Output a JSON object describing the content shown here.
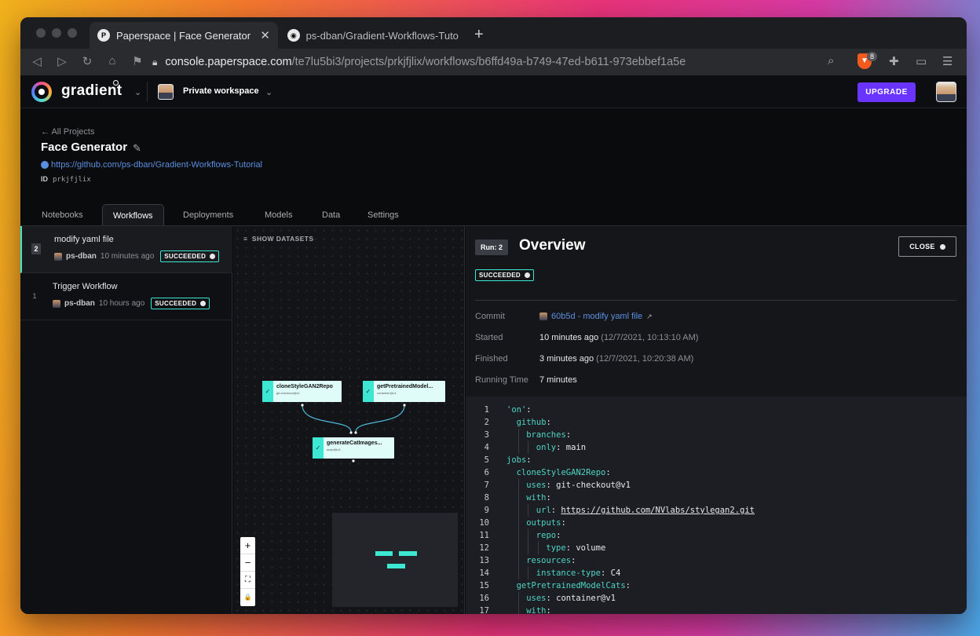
{
  "browser": {
    "tabs": [
      {
        "title": "Paperspace | Face Generator",
        "favicon": "P"
      },
      {
        "title": "ps-dban/Gradient-Workflows-Tutor",
        "favicon": "github-icon"
      }
    ],
    "url_host": "console.paperspace.com",
    "url_path": "/te7lu5bi3/projects/prkjfjlix/workflows/b6ffd49a-b749-47ed-b611-973ebbef1a5e",
    "shield_badge": "8"
  },
  "app": {
    "logo_text": "gradient",
    "workspace": "Private workspace",
    "upgrade_label": "UPGRADE"
  },
  "project": {
    "back_label": "← All Projects",
    "title": "Face Generator",
    "repo_url": "https://github.com/ps-dban/Gradient-Workflows-Tutorial",
    "id_label": "ID",
    "id_value": "prkjfjlix",
    "tabs": [
      "Notebooks",
      "Workflows",
      "Deployments",
      "Models",
      "Data",
      "Settings"
    ],
    "active_tab": "Workflows"
  },
  "runs": [
    {
      "num": "2",
      "title": "modify yaml file",
      "user": "ps-dban",
      "time": "10 minutes ago",
      "status": "SUCCEEDED"
    },
    {
      "num": "1",
      "title": "Trigger Workflow",
      "user": "ps-dban",
      "time": "10 hours ago",
      "status": "SUCCEEDED"
    }
  ],
  "graph": {
    "show_datasets": "SHOW DATASETS",
    "nodes": [
      {
        "name": "cloneStyleGAN2Repo",
        "sub": "git-checkout@v1"
      },
      {
        "name": "getPretrainedModel...",
        "sub": "container@v1"
      },
      {
        "name": "generateCatImages...",
        "sub": "script@v1"
      }
    ],
    "zoom_controls": [
      "+",
      "−",
      "⛶",
      "🔒"
    ]
  },
  "overview": {
    "run_chip": "Run: 2",
    "title": "Overview",
    "close_label": "CLOSE",
    "status": "SUCCEEDED",
    "details": {
      "commit_label": "Commit",
      "commit_value": "60b5d - modify yaml file",
      "started_label": "Started",
      "started_value": "10 minutes ago",
      "started_abs": "(12/7/2021, 10:13:10 AM)",
      "finished_label": "Finished",
      "finished_value": "3 minutes ago",
      "finished_abs": "(12/7/2021, 10:20:38 AM)",
      "running_label": "Running Time",
      "running_value": "7 minutes"
    }
  },
  "yaml_lines": [
    {
      "n": "1",
      "indent": 0,
      "k": "'on'",
      "v": ""
    },
    {
      "n": "2",
      "indent": 1,
      "k": "github",
      "v": ""
    },
    {
      "n": "3",
      "indent": 2,
      "k": "branches",
      "v": ""
    },
    {
      "n": "4",
      "indent": 3,
      "k": "only",
      "v": "main"
    },
    {
      "n": "5",
      "indent": 0,
      "k": "jobs",
      "v": ""
    },
    {
      "n": "6",
      "indent": 1,
      "k": "cloneStyleGAN2Repo",
      "v": ""
    },
    {
      "n": "7",
      "indent": 2,
      "k": "uses",
      "v": "git-checkout@v1"
    },
    {
      "n": "8",
      "indent": 2,
      "k": "with",
      "v": ""
    },
    {
      "n": "9",
      "indent": 3,
      "k": "url",
      "v": "https://github.com/NVlabs/stylegan2.git",
      "is_url": true
    },
    {
      "n": "10",
      "indent": 2,
      "k": "outputs",
      "v": ""
    },
    {
      "n": "11",
      "indent": 3,
      "k": "repo",
      "v": ""
    },
    {
      "n": "12",
      "indent": 4,
      "k": "type",
      "v": "volume"
    },
    {
      "n": "13",
      "indent": 2,
      "k": "resources",
      "v": ""
    },
    {
      "n": "14",
      "indent": 3,
      "k": "instance-type",
      "v": "C4"
    },
    {
      "n": "15",
      "indent": 1,
      "k": "getPretrainedModelCats",
      "v": ""
    },
    {
      "n": "16",
      "indent": 2,
      "k": "uses",
      "v": "container@v1"
    },
    {
      "n": "17",
      "indent": 2,
      "k": "with",
      "v": ""
    }
  ],
  "colors": {
    "accent_teal": "#3ce8d2",
    "upgrade_purple": "#6a34ff",
    "link_blue": "#5b8fe0"
  }
}
